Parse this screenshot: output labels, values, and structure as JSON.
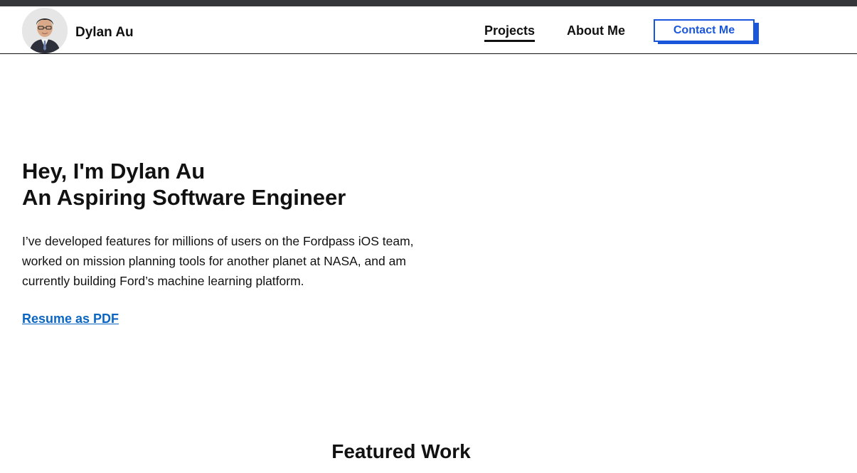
{
  "header": {
    "name": "Dylan Au",
    "avatar_icon": "person-portrait-icon",
    "nav": {
      "projects_label": "Projects",
      "about_label": "About Me",
      "contact_label": "Contact Me"
    }
  },
  "hero": {
    "greeting": "Hey, I'm Dylan Au",
    "tagline": "An Aspiring Software Engineer",
    "description": "I’ve developed features for millions of users on the Fordpass iOS team, worked on mission planning tools for another planet at NASA, and am currently building Ford’s machine learning platform.",
    "resume_link": "Resume as PDF"
  },
  "featured": {
    "title": "Featured Work"
  },
  "colors": {
    "accent": "#1a56db",
    "link": "#0b66c3",
    "top_bar": "#35363a",
    "text": "#111111"
  }
}
